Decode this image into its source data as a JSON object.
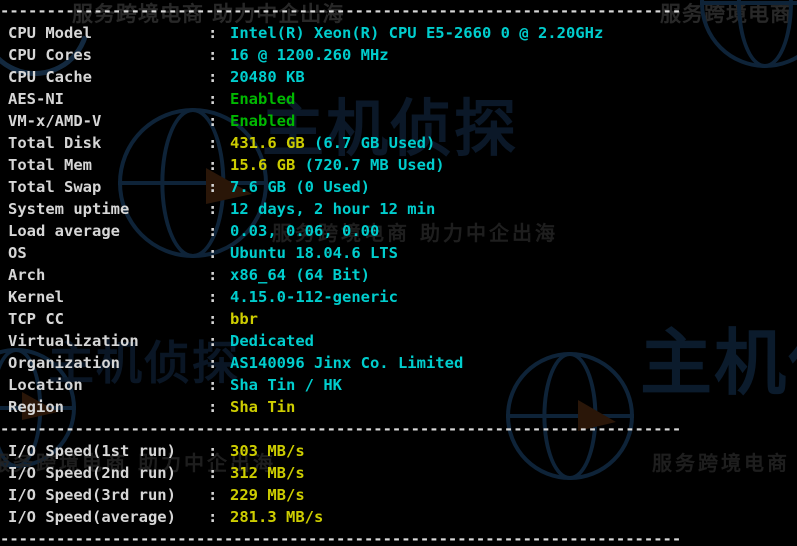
{
  "terminal": {
    "colors": {
      "background": "#000000",
      "label": "#d6d6d6",
      "cyan": "#00cdcd",
      "yellow": "#cdcd00",
      "green": "#00b800",
      "watermark_blue": "#0e2338",
      "watermark_gray": "#2a2a2a"
    },
    "divider_top": "-------------------------------------------------------------------------",
    "divider_mid": "-------------------------------------------------------------------------",
    "divider_bottom": "-------------------------------------------------------------------------",
    "separator": ":"
  },
  "watermarks": {
    "tagline": "服务跨境电商 助力中企出海",
    "brand": "主机侦探",
    "sub": "服务跨境电商"
  },
  "system_info": [
    {
      "label": "CPU Model",
      "value": "Intel(R) Xeon(R) CPU E5-2660 0 @ 2.20GHz",
      "color": "cyan"
    },
    {
      "label": "CPU Cores",
      "value": "16 @ 1200.260 MHz",
      "color": "cyan"
    },
    {
      "label": "CPU Cache",
      "value": "20480 KB",
      "color": "cyan"
    },
    {
      "label": "AES-NI",
      "value": "Enabled",
      "color": "green"
    },
    {
      "label": "VM-x/AMD-V",
      "value": "Enabled",
      "color": "green"
    },
    {
      "label": "Total Disk",
      "value": "431.6 GB",
      "suffix": " (6.7 GB Used)",
      "color": "yellow"
    },
    {
      "label": "Total Mem",
      "value": "15.6 GB",
      "suffix": " (720.7 MB Used)",
      "color": "yellow"
    },
    {
      "label": "Total Swap",
      "value": "7.6 GB (0 Used)",
      "color": "cyan"
    },
    {
      "label": "System uptime",
      "value": "12 days, 2 hour 12 min",
      "color": "cyan"
    },
    {
      "label": "Load average",
      "value": "0.03, 0.06, 0.00",
      "color": "cyan"
    },
    {
      "label": "OS",
      "value": "Ubuntu 18.04.6 LTS",
      "color": "cyan"
    },
    {
      "label": "Arch",
      "value": "x86_64 (64 Bit)",
      "color": "cyan"
    },
    {
      "label": "Kernel",
      "value": "4.15.0-112-generic",
      "color": "cyan"
    },
    {
      "label": "TCP CC",
      "value": "bbr",
      "color": "yellow"
    },
    {
      "label": "Virtualization",
      "value": "Dedicated",
      "color": "cyan"
    },
    {
      "label": "Organization",
      "value": "AS140096 Jinx Co. Limited",
      "color": "cyan"
    },
    {
      "label": "Location",
      "value": "Sha Tin / HK",
      "color": "cyan"
    },
    {
      "label": "Region",
      "value": "Sha Tin",
      "color": "yellow"
    }
  ],
  "io_speed": [
    {
      "label": "I/O Speed(1st run)",
      "value": "303 MB/s",
      "color": "yellow"
    },
    {
      "label": "I/O Speed(2nd run)",
      "value": "312 MB/s",
      "color": "yellow"
    },
    {
      "label": "I/O Speed(3rd run)",
      "value": "229 MB/s",
      "color": "yellow"
    },
    {
      "label": "I/O Speed(average)",
      "value": "281.3 MB/s",
      "color": "yellow"
    }
  ]
}
